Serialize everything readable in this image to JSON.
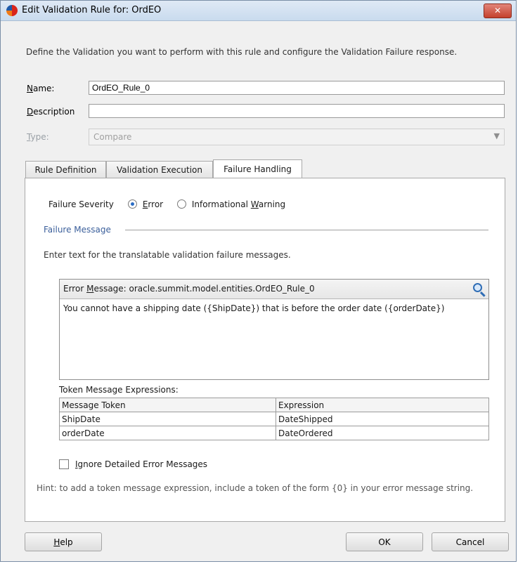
{
  "window": {
    "title": "Edit Validation Rule for: OrdEO",
    "close_glyph": "✕"
  },
  "intro": "Define the Validation you want to perform with this rule and configure the Validation Failure response.",
  "form": {
    "name_label": "Name:",
    "name_value": "OrdEO_Rule_0",
    "description_label": "Description",
    "description_value": "",
    "type_label": "Type:",
    "type_value": "Compare"
  },
  "tabs": [
    {
      "label": "Rule Definition"
    },
    {
      "label": "Validation Execution"
    },
    {
      "label": "Failure Handling"
    }
  ],
  "failure": {
    "severity_label": "Failure Severity",
    "options": [
      {
        "label": "Error",
        "selected": true
      },
      {
        "label": "Informational Warning",
        "selected": false
      }
    ],
    "message_section_title": "Failure Message",
    "message_intro": "Enter text for the translatable validation failure messages.",
    "error_message_header": "Error Message: oracle.summit.model.entities.OrdEO_Rule_0",
    "error_message_text": "You cannot have a shipping date ({ShipDate}) that is before the order date ({orderDate})",
    "token_label": "Token Message Expressions:",
    "token_columns": [
      "Message Token",
      "Expression"
    ],
    "tokens": [
      {
        "token": "ShipDate",
        "expression": "DateShipped"
      },
      {
        "token": "orderDate",
        "expression": "DateOrdered"
      }
    ],
    "ignore_label": "Ignore Detailed Error Messages",
    "ignore_checked": false,
    "hint": "Hint: to add a token message expression, include a token of the form {0} in your error message string."
  },
  "buttons": {
    "help": "Help",
    "ok": "OK",
    "cancel": "Cancel"
  },
  "colors": {
    "section_title": "#3b5f9b",
    "close_button": "#c4402d",
    "radio_dot": "#2a6cc4"
  },
  "icons": {
    "app": "oracle-jdeveloper-icon",
    "search": "magnifier-icon"
  }
}
